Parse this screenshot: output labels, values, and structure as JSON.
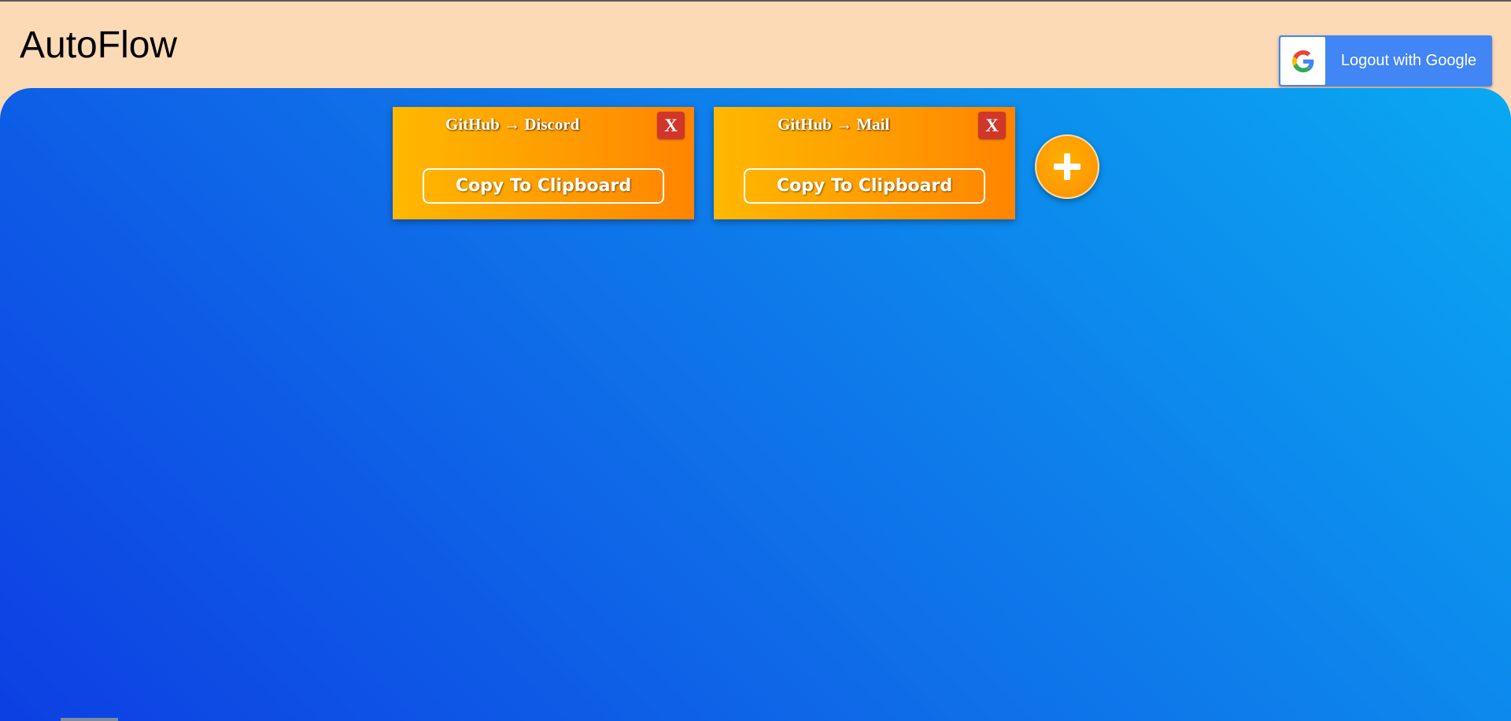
{
  "header": {
    "title": "AutoFlow",
    "logout_label": "Logout with Google",
    "logout_icon": "google-g-icon"
  },
  "workflows": [
    {
      "title": "GitHub → Discord",
      "close_label": "X",
      "copy_label": "Copy To Clipboard"
    },
    {
      "title": "GitHub → Mail",
      "close_label": "X",
      "copy_label": "Copy To Clipboard"
    }
  ],
  "add_button": {
    "icon": "plus-icon"
  },
  "colors": {
    "header_bg": "#fcdab6",
    "main_gradient_start": "#0d3fe3",
    "main_gradient_end": "#0aa8f2",
    "card_gradient_start": "#ffb800",
    "card_gradient_end": "#ff8400",
    "close_button": "#d0362a",
    "google_button": "#4285f4"
  }
}
